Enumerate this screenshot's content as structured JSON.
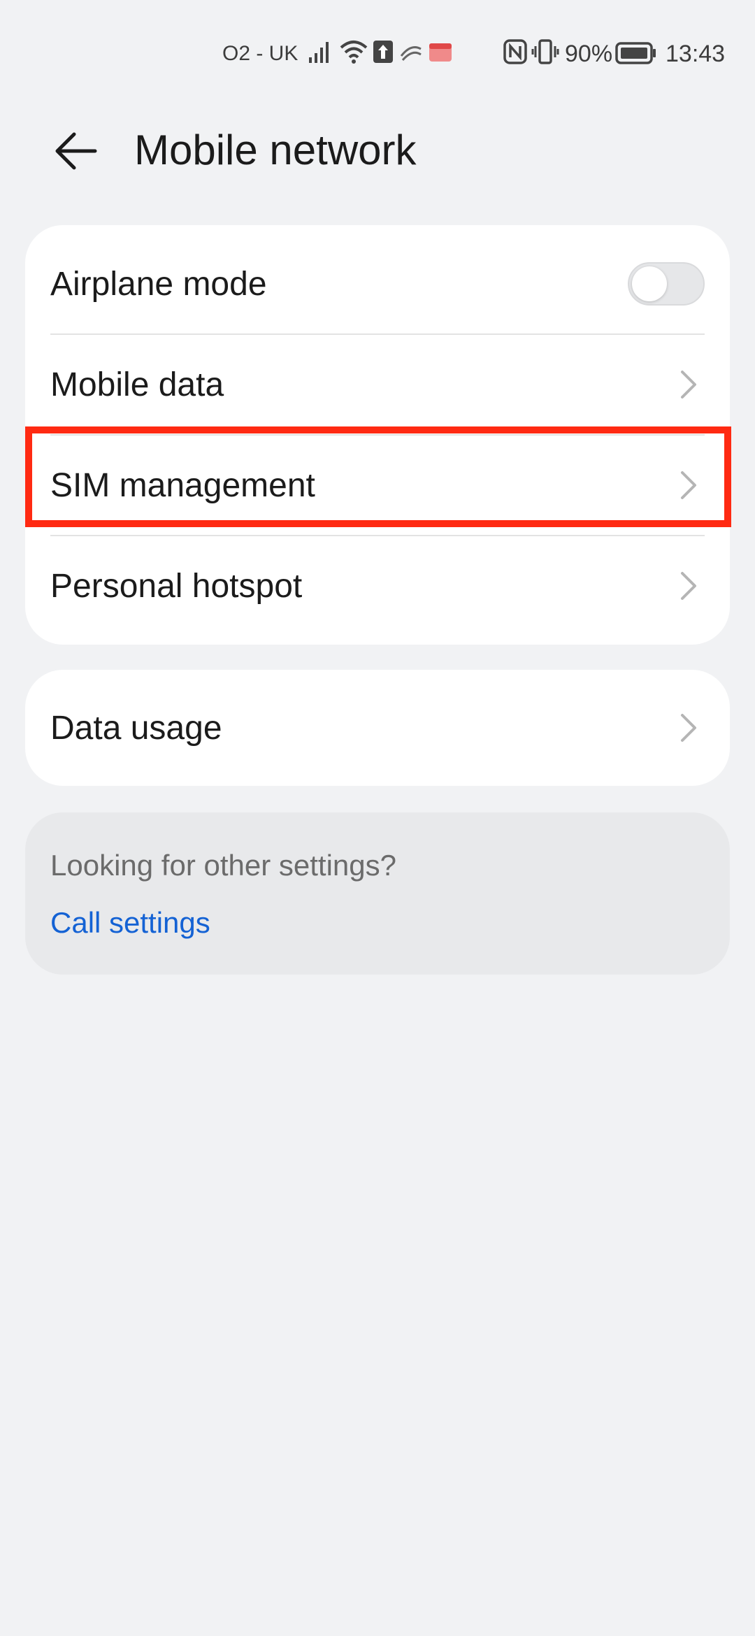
{
  "status_bar": {
    "carrier": "O2 - UK",
    "battery": "90%",
    "time": "13:43"
  },
  "header": {
    "title": "Mobile network",
    "back_icon": "back-arrow-icon"
  },
  "network_card": {
    "airplane_mode": {
      "label": "Airplane mode",
      "toggle_on": false
    },
    "mobile_data": {
      "label": "Mobile data"
    },
    "sim_management": {
      "label": "SIM management"
    },
    "personal_hotspot": {
      "label": "Personal hotspot"
    }
  },
  "usage_card": {
    "data_usage": {
      "label": "Data usage"
    }
  },
  "suggestions": {
    "title": "Looking for other settings?",
    "link": "Call settings"
  },
  "colors": {
    "background": "#f1f2f4",
    "card": "#ffffff",
    "link": "#1462d4",
    "highlight": "#ff2a12"
  }
}
